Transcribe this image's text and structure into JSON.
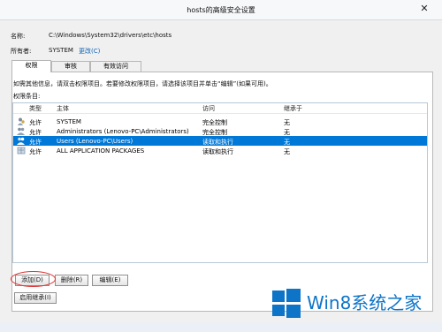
{
  "window": {
    "title": "hosts的高级安全设置"
  },
  "name_label": "名称:",
  "path": "C:\\Windows\\System32\\drivers\\etc\\hosts",
  "owner_label": "所有者:",
  "owner_value": "SYSTEM",
  "change_link": "更改(C)",
  "tabs": [
    "权限",
    "审核",
    "有效访问"
  ],
  "info_text": "如需其他信息，请双击权限项目。若要修改权限项目，请选择该项目并单击“编辑”(如果可用)。",
  "entries_label": "权限条目:",
  "columns": [
    "类型",
    "主体",
    "访问",
    "继承于"
  ],
  "rows": [
    {
      "type": "允许",
      "principal": "SYSTEM",
      "access": "完全控制",
      "inherited": "无",
      "selected": false
    },
    {
      "type": "允许",
      "principal": "Administrators (Lenovo-PC\\Administrators)",
      "access": "完全控制",
      "inherited": "无",
      "selected": false
    },
    {
      "type": "允许",
      "principal": "Users (Lenovo-PC\\Users)",
      "access": "读取和执行",
      "inherited": "无",
      "selected": true
    },
    {
      "type": "允许",
      "principal": "ALL APPLICATION PACKAGES",
      "access": "读取和执行",
      "inherited": "无",
      "selected": false
    }
  ],
  "buttons": {
    "add": "添加(D)",
    "remove": "删除(R)",
    "edit": "编辑(E)",
    "enable_inheritance": "启用继承(I)"
  },
  "watermark": "Win8系统之家",
  "colors": {
    "selection": "#0078d7",
    "annotation": "#df3434",
    "link": "#0c61b5",
    "watermark": "#0d74c8"
  }
}
